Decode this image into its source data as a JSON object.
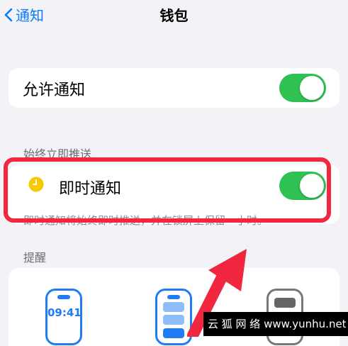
{
  "nav": {
    "back_label": "通知",
    "title": "钱包"
  },
  "allow": {
    "label": "允许通知",
    "enabled": true
  },
  "immediate_section": {
    "header": "始终立即推送",
    "label": "即时通知",
    "enabled": true,
    "footnote": "即时通知将始终即时推送，并在锁屏上保留一小时。"
  },
  "alerts_section": {
    "header": "提醒",
    "preview_time": "09:41"
  },
  "colors": {
    "accent": "#0a7aff",
    "toggle_on": "#30c153",
    "highlight": "#f0273f",
    "arrow": "#f0273f"
  },
  "watermark": "云 狐 网 络  www.yunhu.net"
}
